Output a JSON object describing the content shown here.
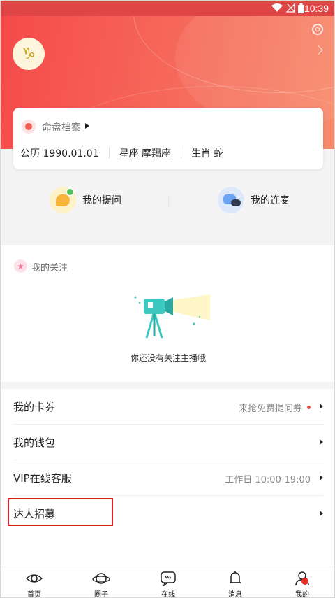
{
  "status_bar": {
    "time": "10:39"
  },
  "profile": {
    "zodiac_symbol": "♑"
  },
  "archive": {
    "label": "命盘档案",
    "birth": "公历 1990.01.01",
    "sign": "星座 摩羯座",
    "zodiac_animal": "生肖 蛇"
  },
  "quick_actions": [
    {
      "label": "我的提问",
      "icon": "question-bubble-icon"
    },
    {
      "label": "我的连麦",
      "icon": "voice-call-icon"
    }
  ],
  "follow_section": {
    "title": "我的关注",
    "empty_text": "你还没有关注主播哦"
  },
  "menu": [
    {
      "label": "我的卡券",
      "right_text": "来抢免费提问券",
      "has_dot": true
    },
    {
      "label": "我的钱包",
      "right_text": ""
    },
    {
      "label": "VIP在线客服",
      "right_text": "工作日 10:00-19:00"
    },
    {
      "label": "达人招募",
      "right_text": ""
    }
  ],
  "tabs": [
    {
      "label": "首页",
      "icon": "eye-icon"
    },
    {
      "label": "圈子",
      "icon": "planet-icon"
    },
    {
      "label": "在线",
      "icon": "chat-icon"
    },
    {
      "label": "消息",
      "icon": "bell-icon"
    },
    {
      "label": "我的",
      "icon": "profile-icon"
    }
  ],
  "colors": {
    "accent": "#f54a4a",
    "hero_gradient_end": "#f78a6a",
    "highlight_box": "#e02020"
  }
}
